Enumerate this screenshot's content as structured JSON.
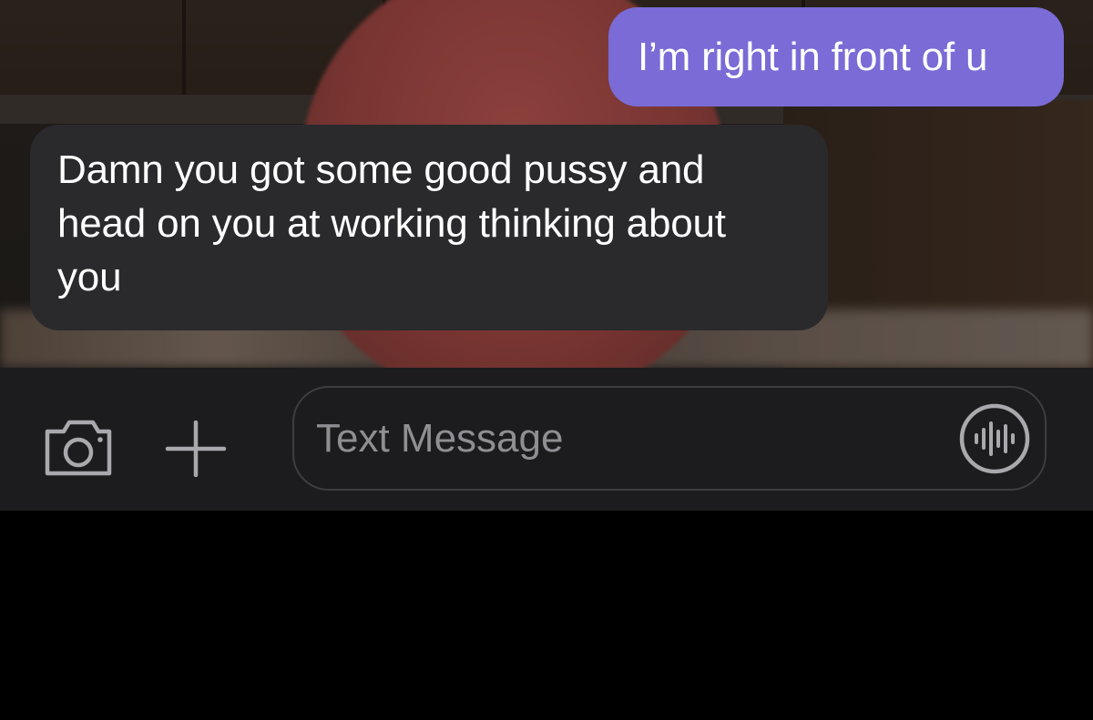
{
  "conversation": {
    "messages": [
      {
        "direction": "sent",
        "text": "I’m right in front of u"
      },
      {
        "direction": "received",
        "text": "Damn you got some good pussy and head on you at working thinking about you"
      }
    ]
  },
  "composer": {
    "placeholder": "Text Message",
    "value": "",
    "left_icons": [
      "camera-icon",
      "plus-icon"
    ],
    "right_icon": "waveform-icon"
  },
  "colors": {
    "sent_bubble": "#7a6bd6",
    "received_bubble": "#2a2a2c",
    "composer_background": "#1c1c1e",
    "icon_gray": "#a8a8ad"
  }
}
